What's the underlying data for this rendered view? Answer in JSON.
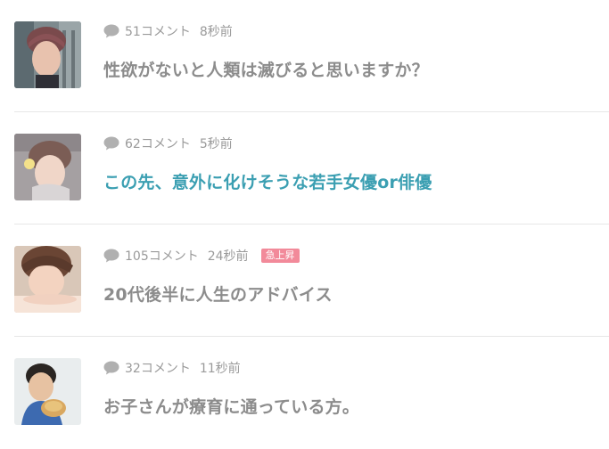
{
  "topics": [
    {
      "comments": "51コメント",
      "time": "8秒前",
      "badge": "",
      "title": "性欲がないと人類は滅びると思いますか？"
    },
    {
      "comments": "62コメント",
      "time": "5秒前",
      "badge": "",
      "title": "この先、意外に化けそうな若手女優or俳優"
    },
    {
      "comments": "105コメント",
      "time": "24秒前",
      "badge": "急上昇",
      "title": "20代後半に人生のアドバイス"
    },
    {
      "comments": "32コメント",
      "time": "11秒前",
      "badge": "",
      "title": "お子さんが療育に通っている方。"
    }
  ],
  "colors": {
    "meta_text": "#9a9a9a",
    "title_text": "#8c8c8c",
    "title_active": "#3b9fb2",
    "badge_bg": "#f28a9a",
    "divider": "#e6e6e6"
  },
  "icons": {
    "comment": "speech-bubble-icon"
  }
}
